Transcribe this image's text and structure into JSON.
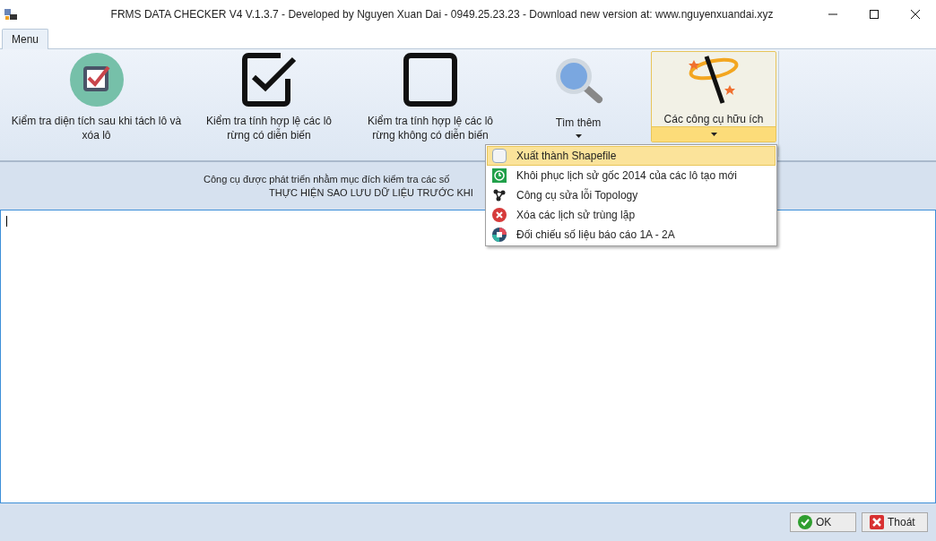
{
  "window": {
    "title": "FRMS DATA CHECKER V4 V.1.3.7 - Developed by Nguyen Xuan Dai - 0949.25.23.23 - Download new version at: www.nguyenxuandai.xyz"
  },
  "tabs": [
    {
      "label": "Menu",
      "selected": true
    }
  ],
  "ribbon": [
    {
      "kind": "badge-check",
      "label": "Kiểm tra diện tích sau khi tách lô và xóa lô",
      "dropdown": false,
      "open": false
    },
    {
      "kind": "check-box",
      "label": "Kiểm tra tính hợp lệ các lô rừng có diễn biến",
      "dropdown": false,
      "open": false
    },
    {
      "kind": "empty-box",
      "label": "Kiểm tra tính hợp lệ các lô rừng không có diễn biến",
      "dropdown": false,
      "open": false
    },
    {
      "kind": "magnifier",
      "label": "Tìm thêm",
      "dropdown": true,
      "open": false
    },
    {
      "kind": "wand",
      "label": "Các công cụ hữu ích",
      "dropdown": true,
      "open": true
    }
  ],
  "dropdown_menu": [
    {
      "kind": "shapefile",
      "label": "Xuất thành Shapefile",
      "selected": true
    },
    {
      "kind": "restore",
      "label": "Khôi phục lịch sử gốc 2014 của các lô tạo mới",
      "selected": false
    },
    {
      "kind": "topology",
      "label": "Công cụ sửa lỗi Topology",
      "selected": false
    },
    {
      "kind": "delete",
      "label": "Xóa các lịch sử trùng lặp",
      "selected": false
    },
    {
      "kind": "compare",
      "label": "Đối chiếu số liệu báo cáo 1A - 2A",
      "selected": false
    }
  ],
  "info": [
    "Công cụ được phát triển nhằm mục đích kiểm tra các số",
    "THỰC HIỆN SAO LƯU DỮ LIỆU TRƯỚC KHI"
  ],
  "buttons": [
    {
      "kind": "ok",
      "label": "OK"
    },
    {
      "kind": "exit",
      "label": "Thoát"
    }
  ]
}
